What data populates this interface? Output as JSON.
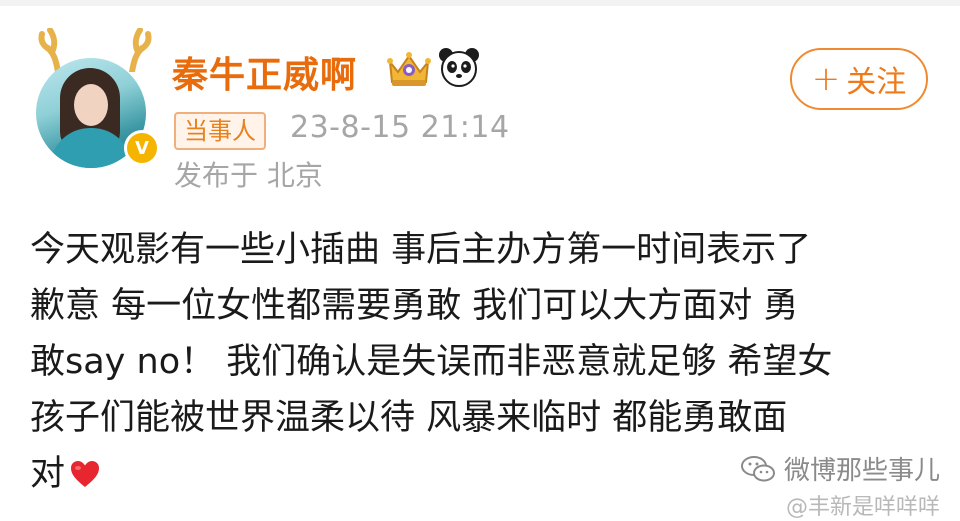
{
  "author": {
    "name": "秦牛正威啊",
    "verified_mark": "V",
    "role_badge": "当事人",
    "timestamp": "23-8-15 21:14",
    "location": "发布于 北京"
  },
  "actions": {
    "follow_label": "关注",
    "follow_plus": "+"
  },
  "post": {
    "lines": [
      "今天观影有一些小插曲 事后主办方第一时间表示了",
      "歉意 每一位女性都需要勇敢 我们可以大方面对 勇",
      "敢say no！ 我们确认是失误而非恶意就足够 希望女",
      "孩子们能被世界温柔以待 风暴来临时 都能勇敢面",
      "对"
    ]
  },
  "watermark": {
    "line1": "微博那些事儿",
    "line2": "@丰新是咩咩咩"
  },
  "icons": {
    "crown": "crown-icon",
    "panda": "panda-icon",
    "heart": "heart-icon",
    "wechat": "wechat-icon",
    "antler": "antler-icon"
  },
  "colors": {
    "username": "#e86b0c",
    "follow_border": "#f08a32",
    "badge_bg": "#fff3ea",
    "meta_gray": "#a6a6a6",
    "verified": "#f4b400",
    "heart": "#e8262f"
  }
}
